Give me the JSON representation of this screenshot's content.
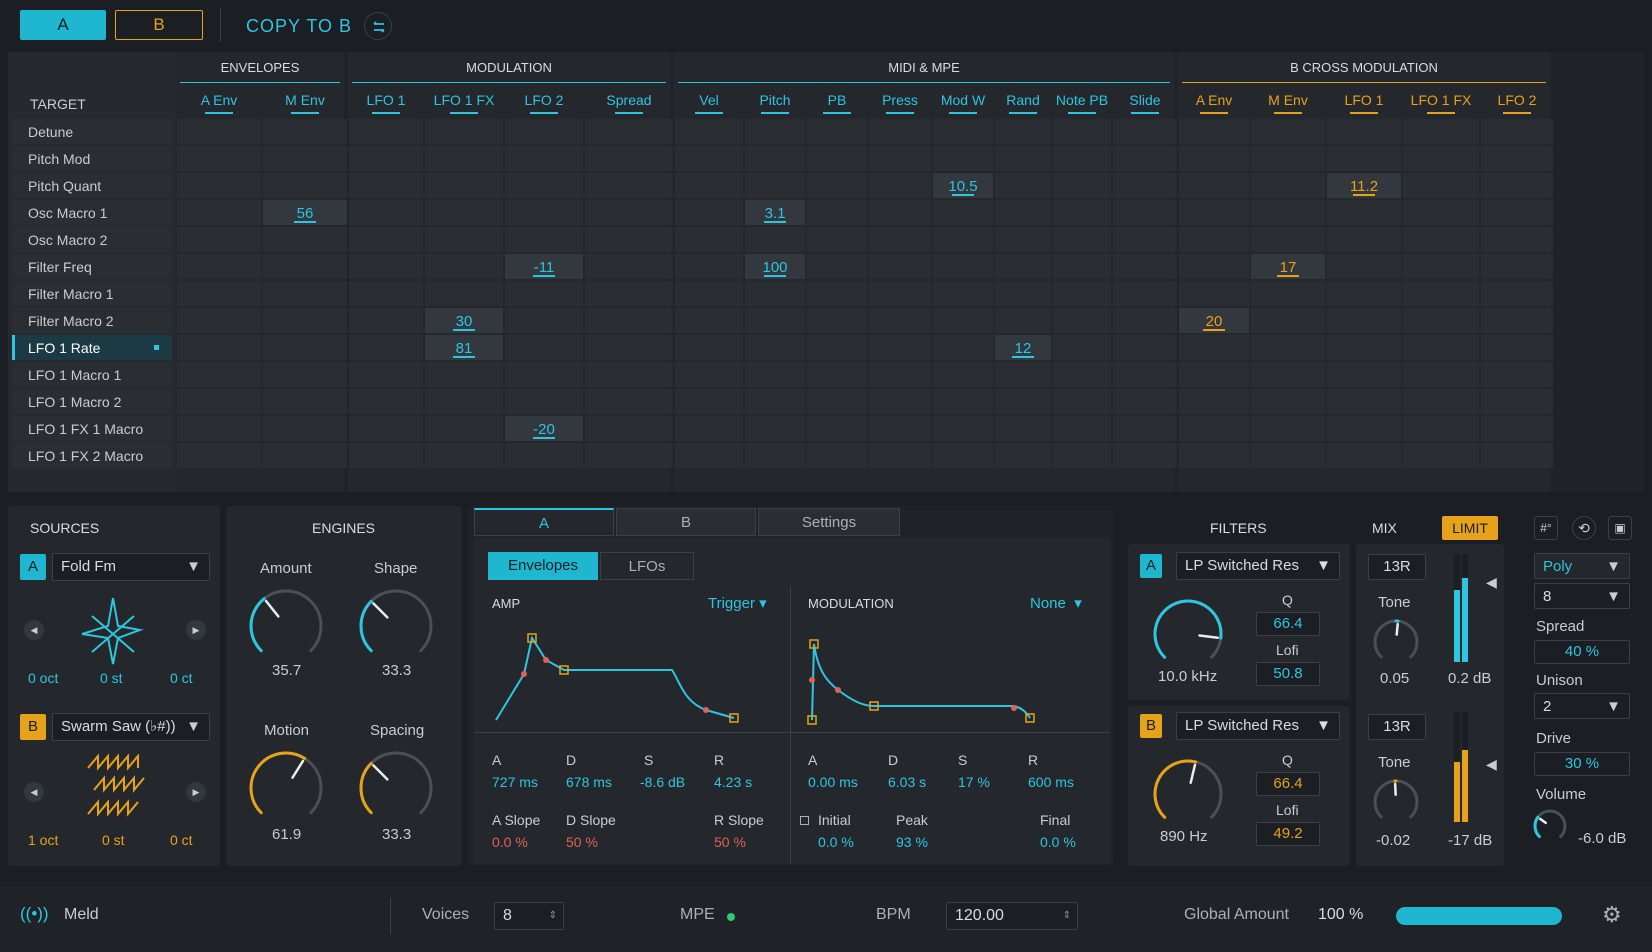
{
  "header": {
    "a_label": "A",
    "b_label": "B",
    "copy_label": "COPY TO B"
  },
  "matrix": {
    "target_header": "TARGET",
    "groups": [
      {
        "name": "ENVELOPES",
        "color": "#2ec5e0"
      },
      {
        "name": "MODULATION",
        "color": "#2ec5e0"
      },
      {
        "name": "MIDI & MPE",
        "color": "#2ec5e0"
      },
      {
        "name": "B CROSS MODULATION",
        "color": "#e6a21a"
      }
    ],
    "columns": [
      "A Env",
      "M Env",
      "LFO 1",
      "LFO 1 FX",
      "LFO 2",
      "Spread",
      "Vel",
      "Pitch",
      "PB",
      "Press",
      "Mod W",
      "Rand",
      "Note PB",
      "Slide",
      "A Env",
      "M Env",
      "LFO 1",
      "LFO 1 FX",
      "LFO 2"
    ],
    "targets": [
      "Detune",
      "Pitch Mod",
      "Pitch Quant",
      "Osc Macro 1",
      "Osc Macro 2",
      "Filter Freq",
      "Filter Macro 1",
      "Filter Macro 2",
      "LFO 1 Rate",
      "LFO 1 Macro 1",
      "LFO 1 Macro 2",
      "LFO 1 FX 1 Macro",
      "LFO 1 FX 2 Macro"
    ],
    "selected_target": "LFO 1 Rate",
    "cells": [
      {
        "row": 3,
        "col": 1,
        "value": "56"
      },
      {
        "row": 3,
        "col": 7,
        "value": "3.1"
      },
      {
        "row": 2,
        "col": 10,
        "value": "10.5"
      },
      {
        "row": 2,
        "col": 16,
        "value": "11.2"
      },
      {
        "row": 5,
        "col": 4,
        "value": "-11"
      },
      {
        "row": 5,
        "col": 7,
        "value": "100"
      },
      {
        "row": 5,
        "col": 15,
        "value": "17"
      },
      {
        "row": 7,
        "col": 3,
        "value": "30"
      },
      {
        "row": 7,
        "col": 14,
        "value": "20"
      },
      {
        "row": 8,
        "col": 3,
        "value": "81"
      },
      {
        "row": 8,
        "col": 11,
        "value": "12"
      },
      {
        "row": 11,
        "col": 4,
        "value": "-20"
      }
    ]
  },
  "sources": {
    "title": "SOURCES",
    "a": {
      "badge": "A",
      "name": "Fold Fm",
      "oct": "0 oct",
      "st": "0 st",
      "ct": "0 ct"
    },
    "b": {
      "badge": "B",
      "name": "Swarm Saw (♭#))",
      "oct": "1 oct",
      "st": "0 st",
      "ct": "0 ct"
    }
  },
  "engines": {
    "title": "ENGINES",
    "amount_label": "Amount",
    "amount_value": "35.7",
    "amount_level": 0.357,
    "shape_label": "Shape",
    "shape_value": "33.3",
    "shape_level": 0.333,
    "motion_label": "Motion",
    "motion_value": "61.9",
    "motion_level": 0.619,
    "spacing_label": "Spacing",
    "spacing_value": "33.3",
    "spacing_level": 0.333
  },
  "env_panel": {
    "tab_a": "A",
    "tab_b": "B",
    "tab_settings": "Settings",
    "sub_envelopes": "Envelopes",
    "sub_lfos": "LFOs",
    "amp": {
      "title": "AMP",
      "trigger": "Trigger",
      "a_label": "A",
      "a_value": "727 ms",
      "d_label": "D",
      "d_value": "678 ms",
      "s_label": "S",
      "s_value": "-8.6 dB",
      "r_label": "R",
      "r_value": "4.23 s",
      "aslope_label": "A Slope",
      "aslope_value": "0.0 %",
      "dslope_label": "D Slope",
      "dslope_value": "50 %",
      "rslope_label": "R Slope",
      "rslope_value": "50 %"
    },
    "mod": {
      "title": "MODULATION",
      "none": "None",
      "a_label": "A",
      "a_value": "0.00 ms",
      "d_label": "D",
      "d_value": "6.03 s",
      "s_label": "S",
      "s_value": "17 %",
      "r_label": "R",
      "r_value": "600 ms",
      "initial_label": "Initial",
      "initial_value": "0.0 %",
      "peak_label": "Peak",
      "peak_value": "93 %",
      "final_label": "Final",
      "final_value": "0.0 %"
    }
  },
  "filters": {
    "title": "FILTERS",
    "a": {
      "badge": "A",
      "type": "LP Switched Res",
      "freq": "10.0 kHz",
      "q_label": "Q",
      "q_value": "66.4",
      "lofi_label": "Lofi",
      "lofi_value": "50.8"
    },
    "b": {
      "badge": "B",
      "type": "LP Switched Res",
      "freq": "890 Hz",
      "q_label": "Q",
      "q_value": "66.4",
      "lofi_label": "Lofi",
      "lofi_value": "49.2"
    }
  },
  "mix": {
    "title": "MIX",
    "limit": "LIMIT",
    "a": {
      "route": "13R",
      "tone_label": "Tone",
      "tone_value": "0.05",
      "gain": "0.2 dB"
    },
    "b": {
      "route": "13R",
      "tone_label": "Tone",
      "tone_value": "-0.02",
      "gain": "-17 dB"
    }
  },
  "voice": {
    "mode": "Poly",
    "voices": "8",
    "spread_label": "Spread",
    "spread_value": "40 %",
    "unison_label": "Unison",
    "unison_value": "2",
    "drive_label": "Drive",
    "drive_value": "30 %",
    "volume_label": "Volume",
    "volume_value": "-6.0 dB"
  },
  "footer": {
    "device_name": "Meld",
    "voices_label": "Voices",
    "voices_value": "8",
    "mpe_label": "MPE",
    "bpm_label": "BPM",
    "bpm_value": "120.00",
    "global_label": "Global Amount",
    "global_value": "100 %",
    "global_level": 1.0
  }
}
